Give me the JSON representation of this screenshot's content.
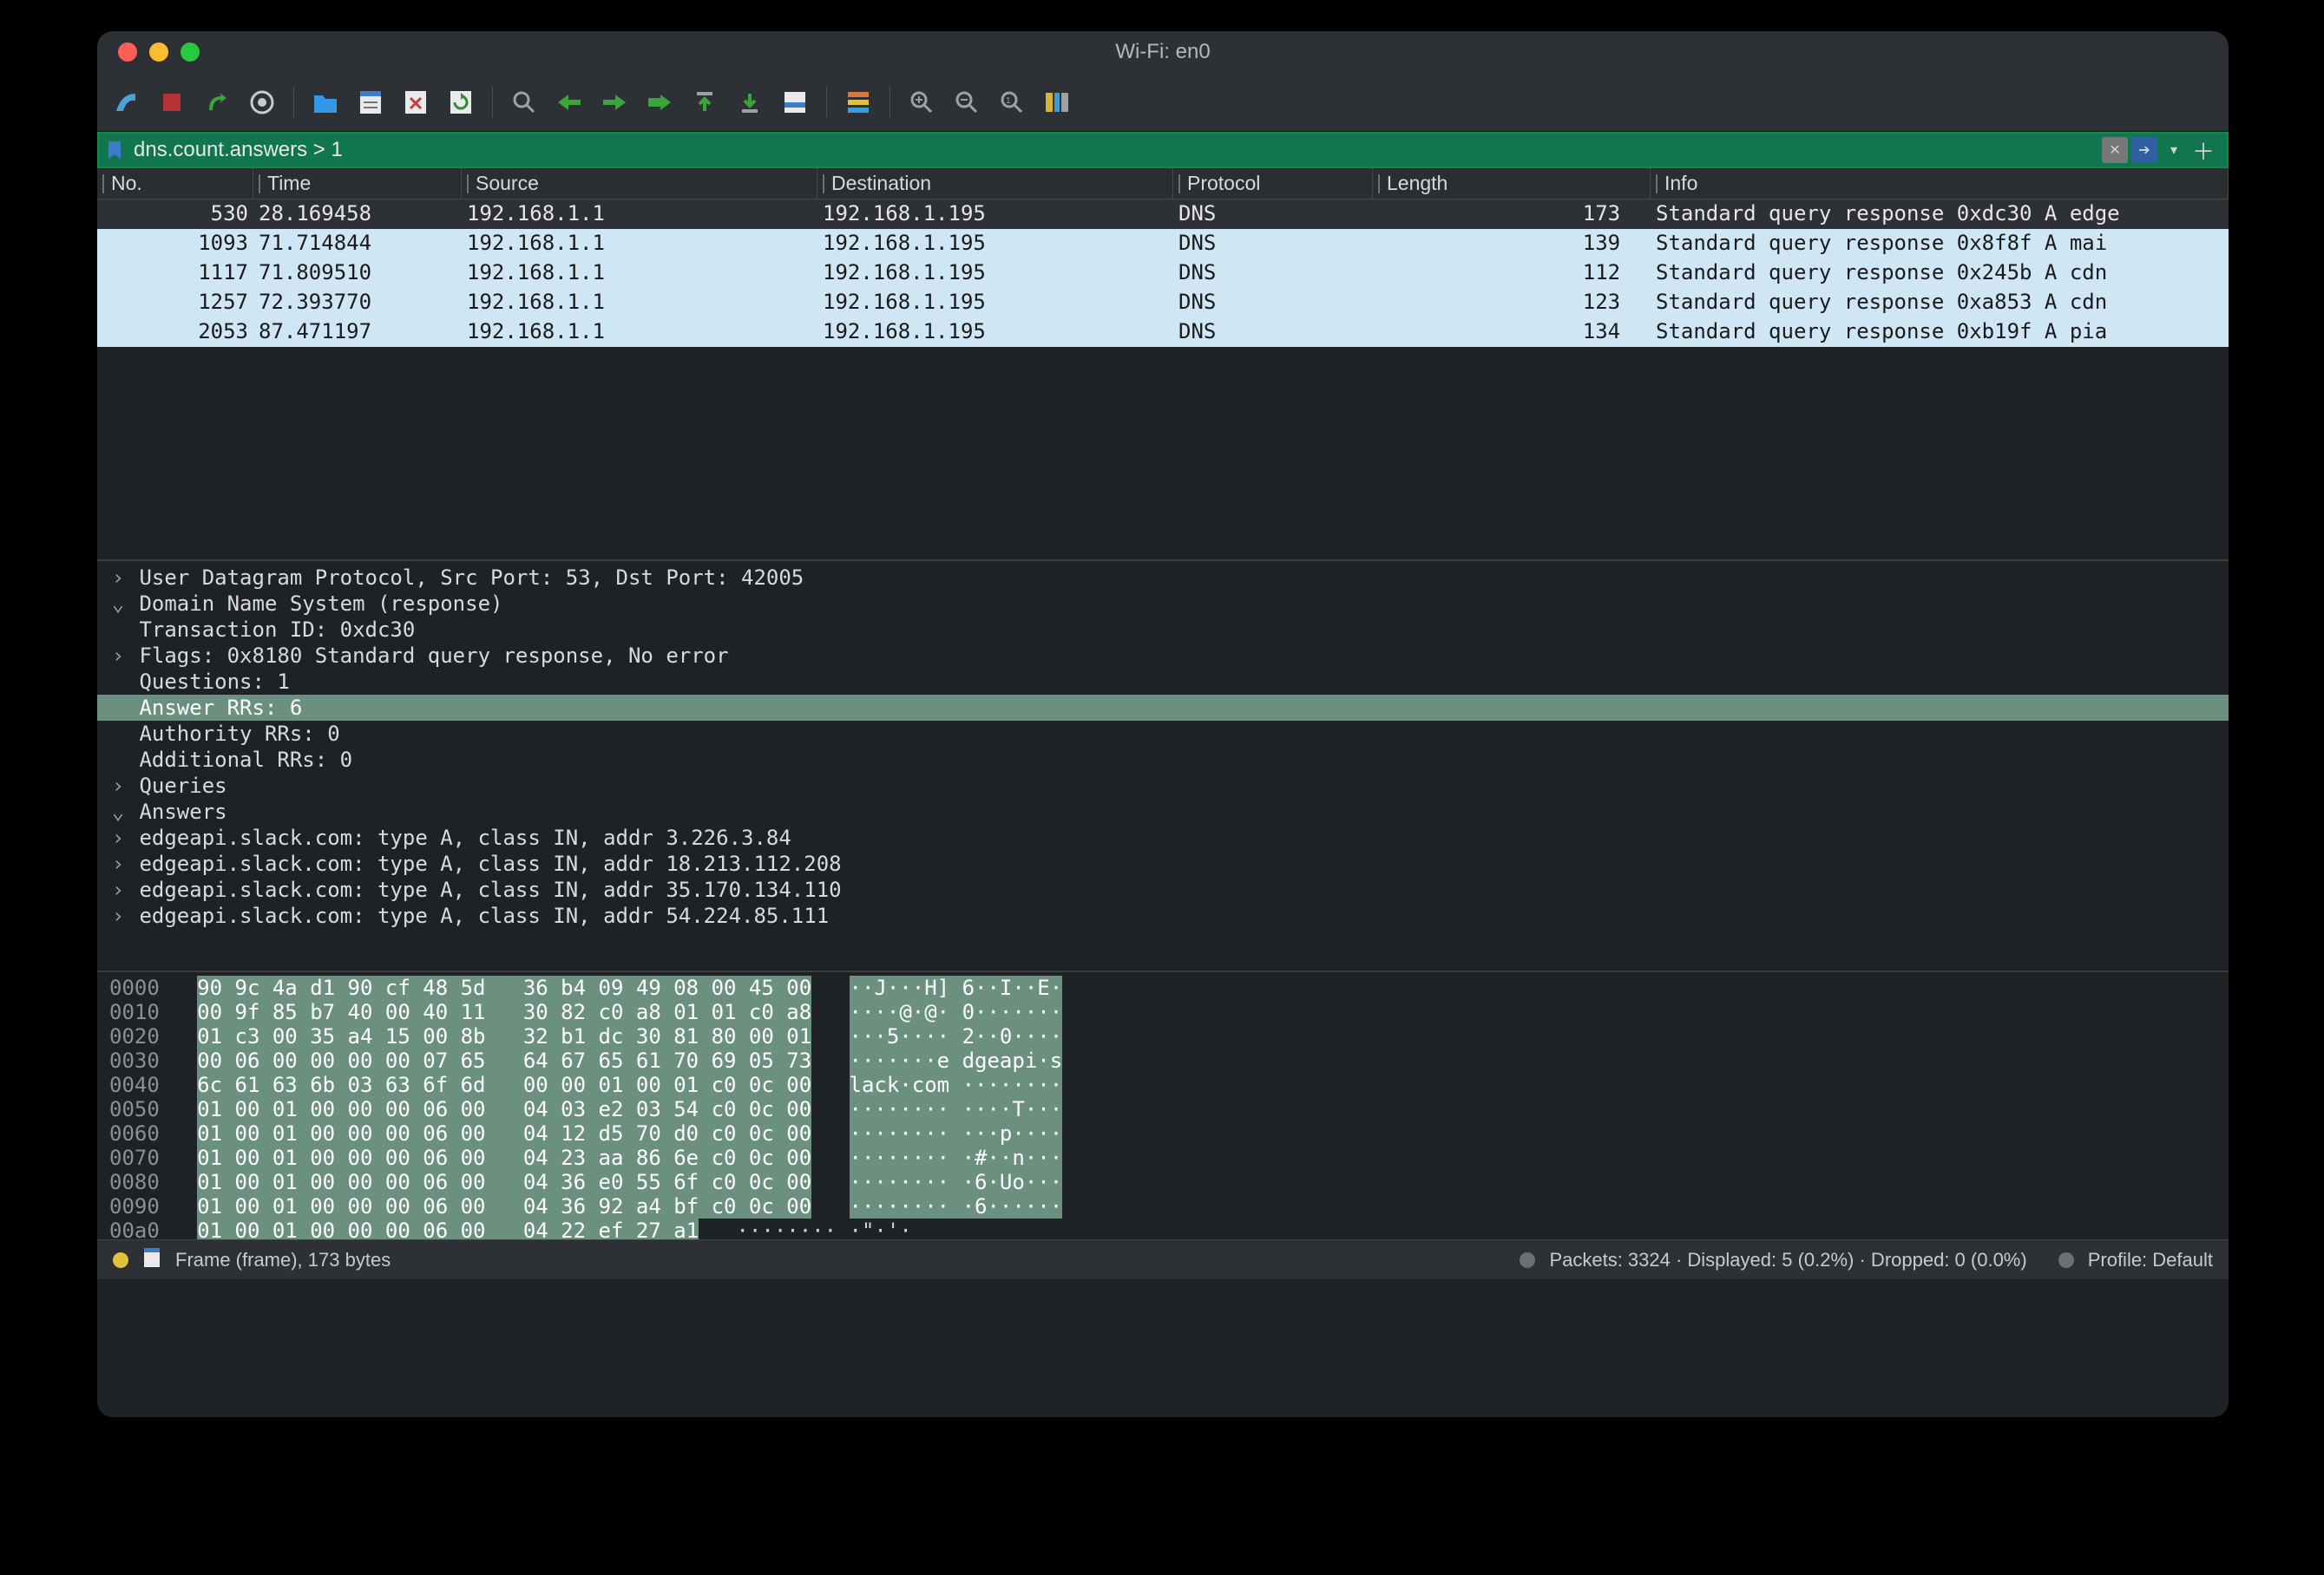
{
  "window_title": "Wi-Fi: en0",
  "filter": "dns.count.answers > 1",
  "columns": [
    "No.",
    "Time",
    "Source",
    "Destination",
    "Protocol",
    "Length",
    "Info"
  ],
  "packet_rows": [
    {
      "no": "530",
      "time": "28.169458",
      "src": "192.168.1.1",
      "dst": "192.168.1.195",
      "proto": "DNS",
      "len": "173",
      "info": "Standard query response 0xdc30 A edge",
      "sel": true
    },
    {
      "no": "1093",
      "time": "71.714844",
      "src": "192.168.1.1",
      "dst": "192.168.1.195",
      "proto": "DNS",
      "len": "139",
      "info": "Standard query response 0x8f8f A mai",
      "sel": false
    },
    {
      "no": "1117",
      "time": "71.809510",
      "src": "192.168.1.1",
      "dst": "192.168.1.195",
      "proto": "DNS",
      "len": "112",
      "info": "Standard query response 0x245b A cdn",
      "sel": false
    },
    {
      "no": "1257",
      "time": "72.393770",
      "src": "192.168.1.1",
      "dst": "192.168.1.195",
      "proto": "DNS",
      "len": "123",
      "info": "Standard query response 0xa853 A cdn",
      "sel": false
    },
    {
      "no": "2053",
      "time": "87.471197",
      "src": "192.168.1.1",
      "dst": "192.168.1.195",
      "proto": "DNS",
      "len": "134",
      "info": "Standard query response 0xb19f A pia",
      "sel": false
    }
  ],
  "details": [
    {
      "indent": 0,
      "exp": ">",
      "txt": "User Datagram Protocol, Src Port: 53, Dst Port: 42005",
      "sel": false
    },
    {
      "indent": 0,
      "exp": "v",
      "txt": "Domain Name System (response)",
      "sel": false
    },
    {
      "indent": 1,
      "exp": "",
      "txt": "Transaction ID: 0xdc30",
      "sel": false
    },
    {
      "indent": 1,
      "exp": ">",
      "txt": "Flags: 0x8180 Standard query response, No error",
      "sel": false
    },
    {
      "indent": 1,
      "exp": "",
      "txt": "Questions: 1",
      "sel": false
    },
    {
      "indent": 1,
      "exp": "",
      "txt": "Answer RRs: 6",
      "sel": true
    },
    {
      "indent": 1,
      "exp": "",
      "txt": "Authority RRs: 0",
      "sel": false
    },
    {
      "indent": 1,
      "exp": "",
      "txt": "Additional RRs: 0",
      "sel": false
    },
    {
      "indent": 1,
      "exp": ">",
      "txt": "Queries",
      "sel": false
    },
    {
      "indent": 1,
      "exp": "v",
      "txt": "Answers",
      "sel": false
    },
    {
      "indent": 2,
      "exp": ">",
      "txt": "edgeapi.slack.com: type A, class IN, addr 3.226.3.84",
      "sel": false
    },
    {
      "indent": 2,
      "exp": ">",
      "txt": "edgeapi.slack.com: type A, class IN, addr 18.213.112.208",
      "sel": false
    },
    {
      "indent": 2,
      "exp": ">",
      "txt": "edgeapi.slack.com: type A, class IN, addr 35.170.134.110",
      "sel": false
    },
    {
      "indent": 2,
      "exp": ">",
      "txt": "edgeapi.slack.com: type A, class IN, addr 54.224.85.111",
      "sel": false
    }
  ],
  "hex": {
    "lines": [
      {
        "off": "0000",
        "h1": "90 9c 4a d1 90 cf 48 5d",
        "h2": "36 b4 09 49 08 00 45 00",
        "a": "··J···H] 6··I··E·"
      },
      {
        "off": "0010",
        "h1": "00 9f 85 b7 40 00 40 11",
        "h2": "30 82 c0 a8 01 01 c0 a8",
        "a": "····@·@· 0·······"
      },
      {
        "off": "0020",
        "h1": "01 c3 00 35 a4 15 00 8b",
        "h2": "32 b1 dc 30 81 80 00 01",
        "a": "···5···· 2··0····"
      },
      {
        "off": "0030",
        "h1": "00 06 00 00 00 00 07 65",
        "h2": "64 67 65 61 70 69 05 73",
        "a": "·······e dgeapi·s",
        "hl_h1": "00 06"
      },
      {
        "off": "0040",
        "h1": "6c 61 63 6b 03 63 6f 6d",
        "h2": "00 00 01 00 01 c0 0c 00",
        "a": "lack·com ········"
      },
      {
        "off": "0050",
        "h1": "01 00 01 00 00 00 06 00",
        "h2": "04 03 e2 03 54 c0 0c 00",
        "a": "········ ····T···"
      },
      {
        "off": "0060",
        "h1": "01 00 01 00 00 00 06 00",
        "h2": "04 12 d5 70 d0 c0 0c 00",
        "a": "········ ···p····"
      },
      {
        "off": "0070",
        "h1": "01 00 01 00 00 00 06 00",
        "h2": "04 23 aa 86 6e c0 0c 00",
        "a": "········ ·#··n···"
      },
      {
        "off": "0080",
        "h1": "01 00 01 00 00 00 06 00",
        "h2": "04 36 e0 55 6f c0 0c 00",
        "a": "········ ·6·Uo···"
      },
      {
        "off": "0090",
        "h1": "01 00 01 00 00 00 06 00",
        "h2": "04 36 92 a4 bf c0 0c 00",
        "a": "········ ·6······"
      },
      {
        "off": "00a0",
        "h1": "01 00 01 00 00 00 06 00",
        "h2": "04 22 ef 27 a1",
        "a": "········ ·\"·'·",
        "short": true
      }
    ]
  },
  "status": {
    "frame_info": "Frame (frame), 173 bytes",
    "packets": "Packets: 3324 · Displayed: 5 (0.2%) · Dropped: 0 (0.0%)",
    "profile": "Profile: Default"
  }
}
